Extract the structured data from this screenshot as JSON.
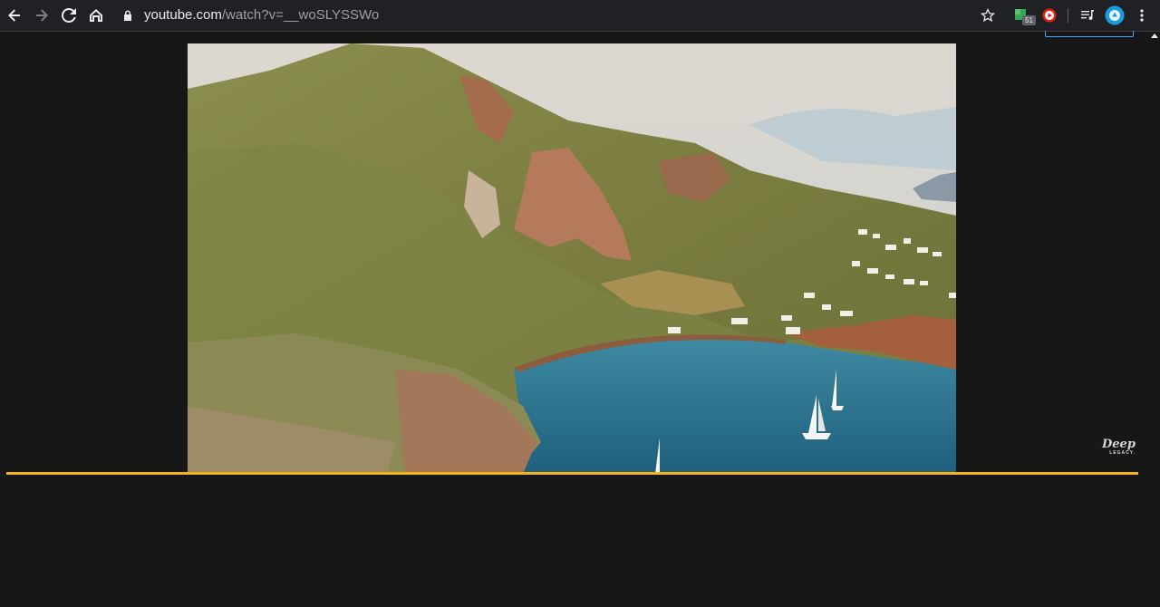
{
  "browser": {
    "url_host": "youtube.com",
    "url_path": "/watch?v=__woSLYSSWo",
    "extension_badge": "51",
    "icons": [
      "back-arrow-icon",
      "forward-arrow-icon",
      "reload-icon",
      "home-icon",
      "lock-icon",
      "star-icon",
      "extension-icon",
      "youtube-extension-icon",
      "media-control-icon",
      "profile-icon",
      "menu-icon"
    ]
  },
  "player": {
    "progress_color": "#f2b51c",
    "watermark_main": "Deep",
    "watermark_sub": "LEGACY."
  },
  "colors": {
    "page_background": "#171717",
    "toolbar_background": "#202124"
  }
}
